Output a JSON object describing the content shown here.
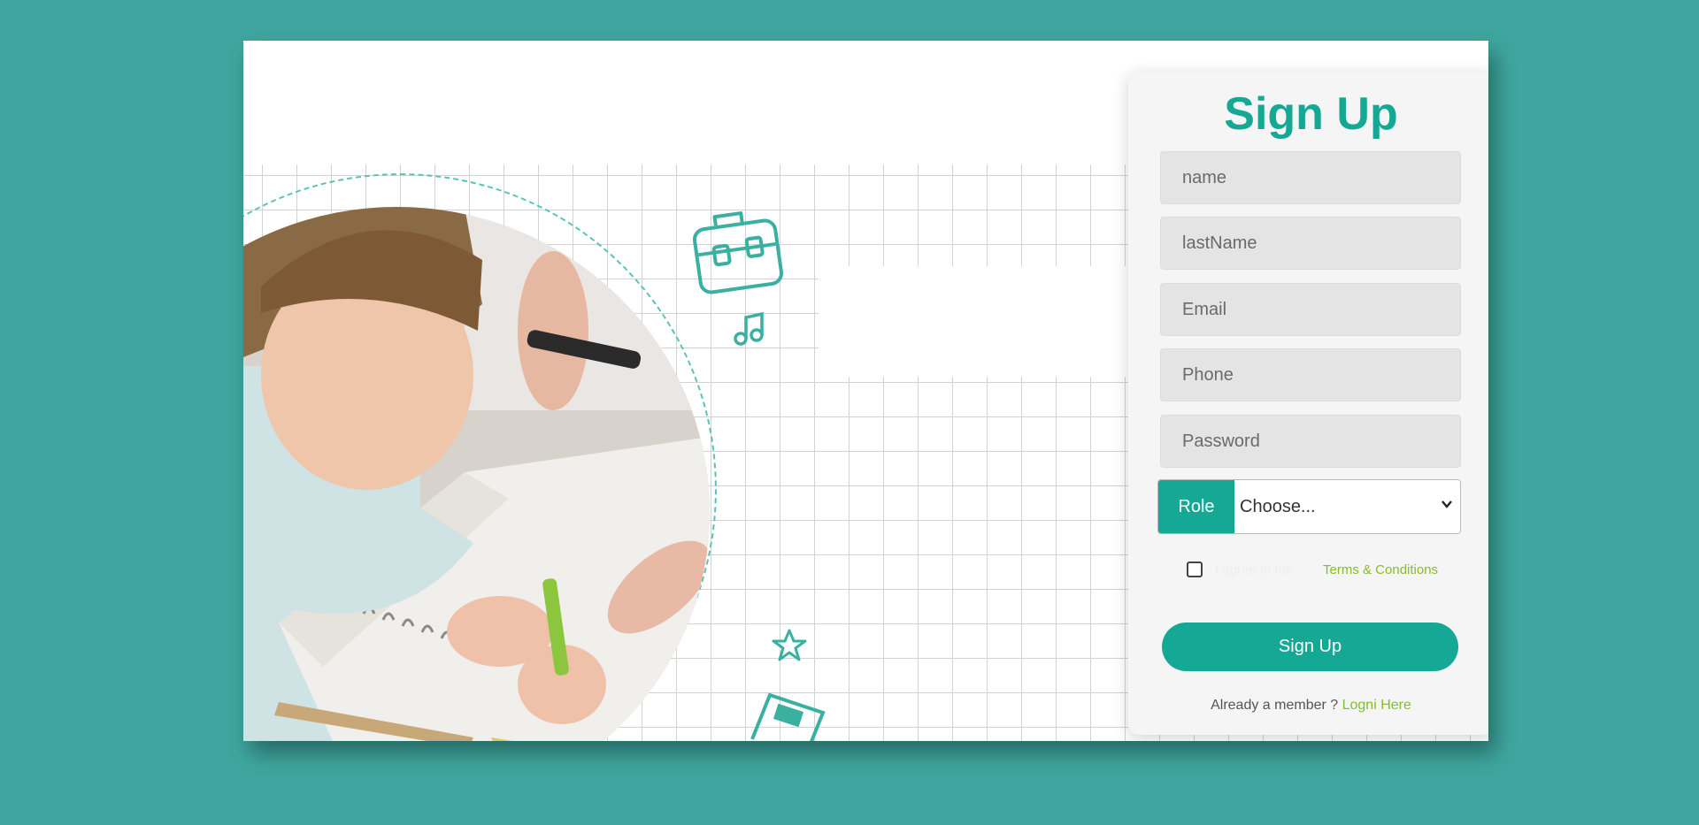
{
  "form": {
    "title": "Sign Up",
    "fields": {
      "name_placeholder": "name",
      "lastname_placeholder": "lastName",
      "email_placeholder": "Email",
      "phone_placeholder": "Phone",
      "password_placeholder": "Password"
    },
    "role": {
      "label": "Role",
      "selected": "Choose..."
    },
    "terms": {
      "text": "I agree to the",
      "link": "Terms & Conditions"
    },
    "submit_label": "Sign Up",
    "footer": {
      "text": "Already a member ? ",
      "link": "Logni Here"
    }
  },
  "colors": {
    "background": "#3ea69e",
    "accent": "#15a894",
    "link": "#86bd2c",
    "doodle": "#3ab0a0"
  },
  "icons": [
    "briefcase-icon",
    "music-note-icon",
    "star-icon",
    "book-icon",
    "pencil-cup-icon",
    "backpack-icon",
    "pencil-icon",
    "chevron-down-icon"
  ]
}
